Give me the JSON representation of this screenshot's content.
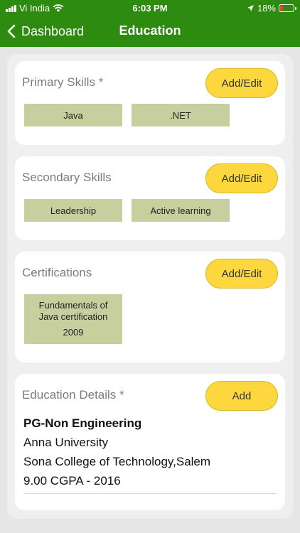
{
  "status_bar": {
    "carrier": "Vi India",
    "time": "6:03 PM",
    "battery": "18%"
  },
  "nav": {
    "back_label": "Dashboard",
    "title": "Education"
  },
  "sections": {
    "primary": {
      "title": "Primary Skills *",
      "button": "Add/Edit",
      "chips": [
        "Java",
        ".NET"
      ]
    },
    "secondary": {
      "title": "Secondary Skills",
      "button": "Add/Edit",
      "chips": [
        "Leadership",
        "Active learning"
      ]
    },
    "certifications": {
      "title": "Certifications",
      "button": "Add/Edit",
      "items": [
        {
          "name_line1": "Fundamentals of",
          "name_line2": "Java certification",
          "year": "2009"
        }
      ]
    },
    "education": {
      "title": "Education Details *",
      "button": "Add",
      "entries": [
        {
          "degree": "PG-Non Engineering",
          "university": "Anna University",
          "college": "Sona College of Technology,Salem",
          "score": "9.00 CGPA - 2016"
        }
      ]
    }
  },
  "colors": {
    "header_green": "#2d8b0f",
    "button_yellow": "#fcd73d",
    "chip_olive": "#c7cf9f"
  }
}
